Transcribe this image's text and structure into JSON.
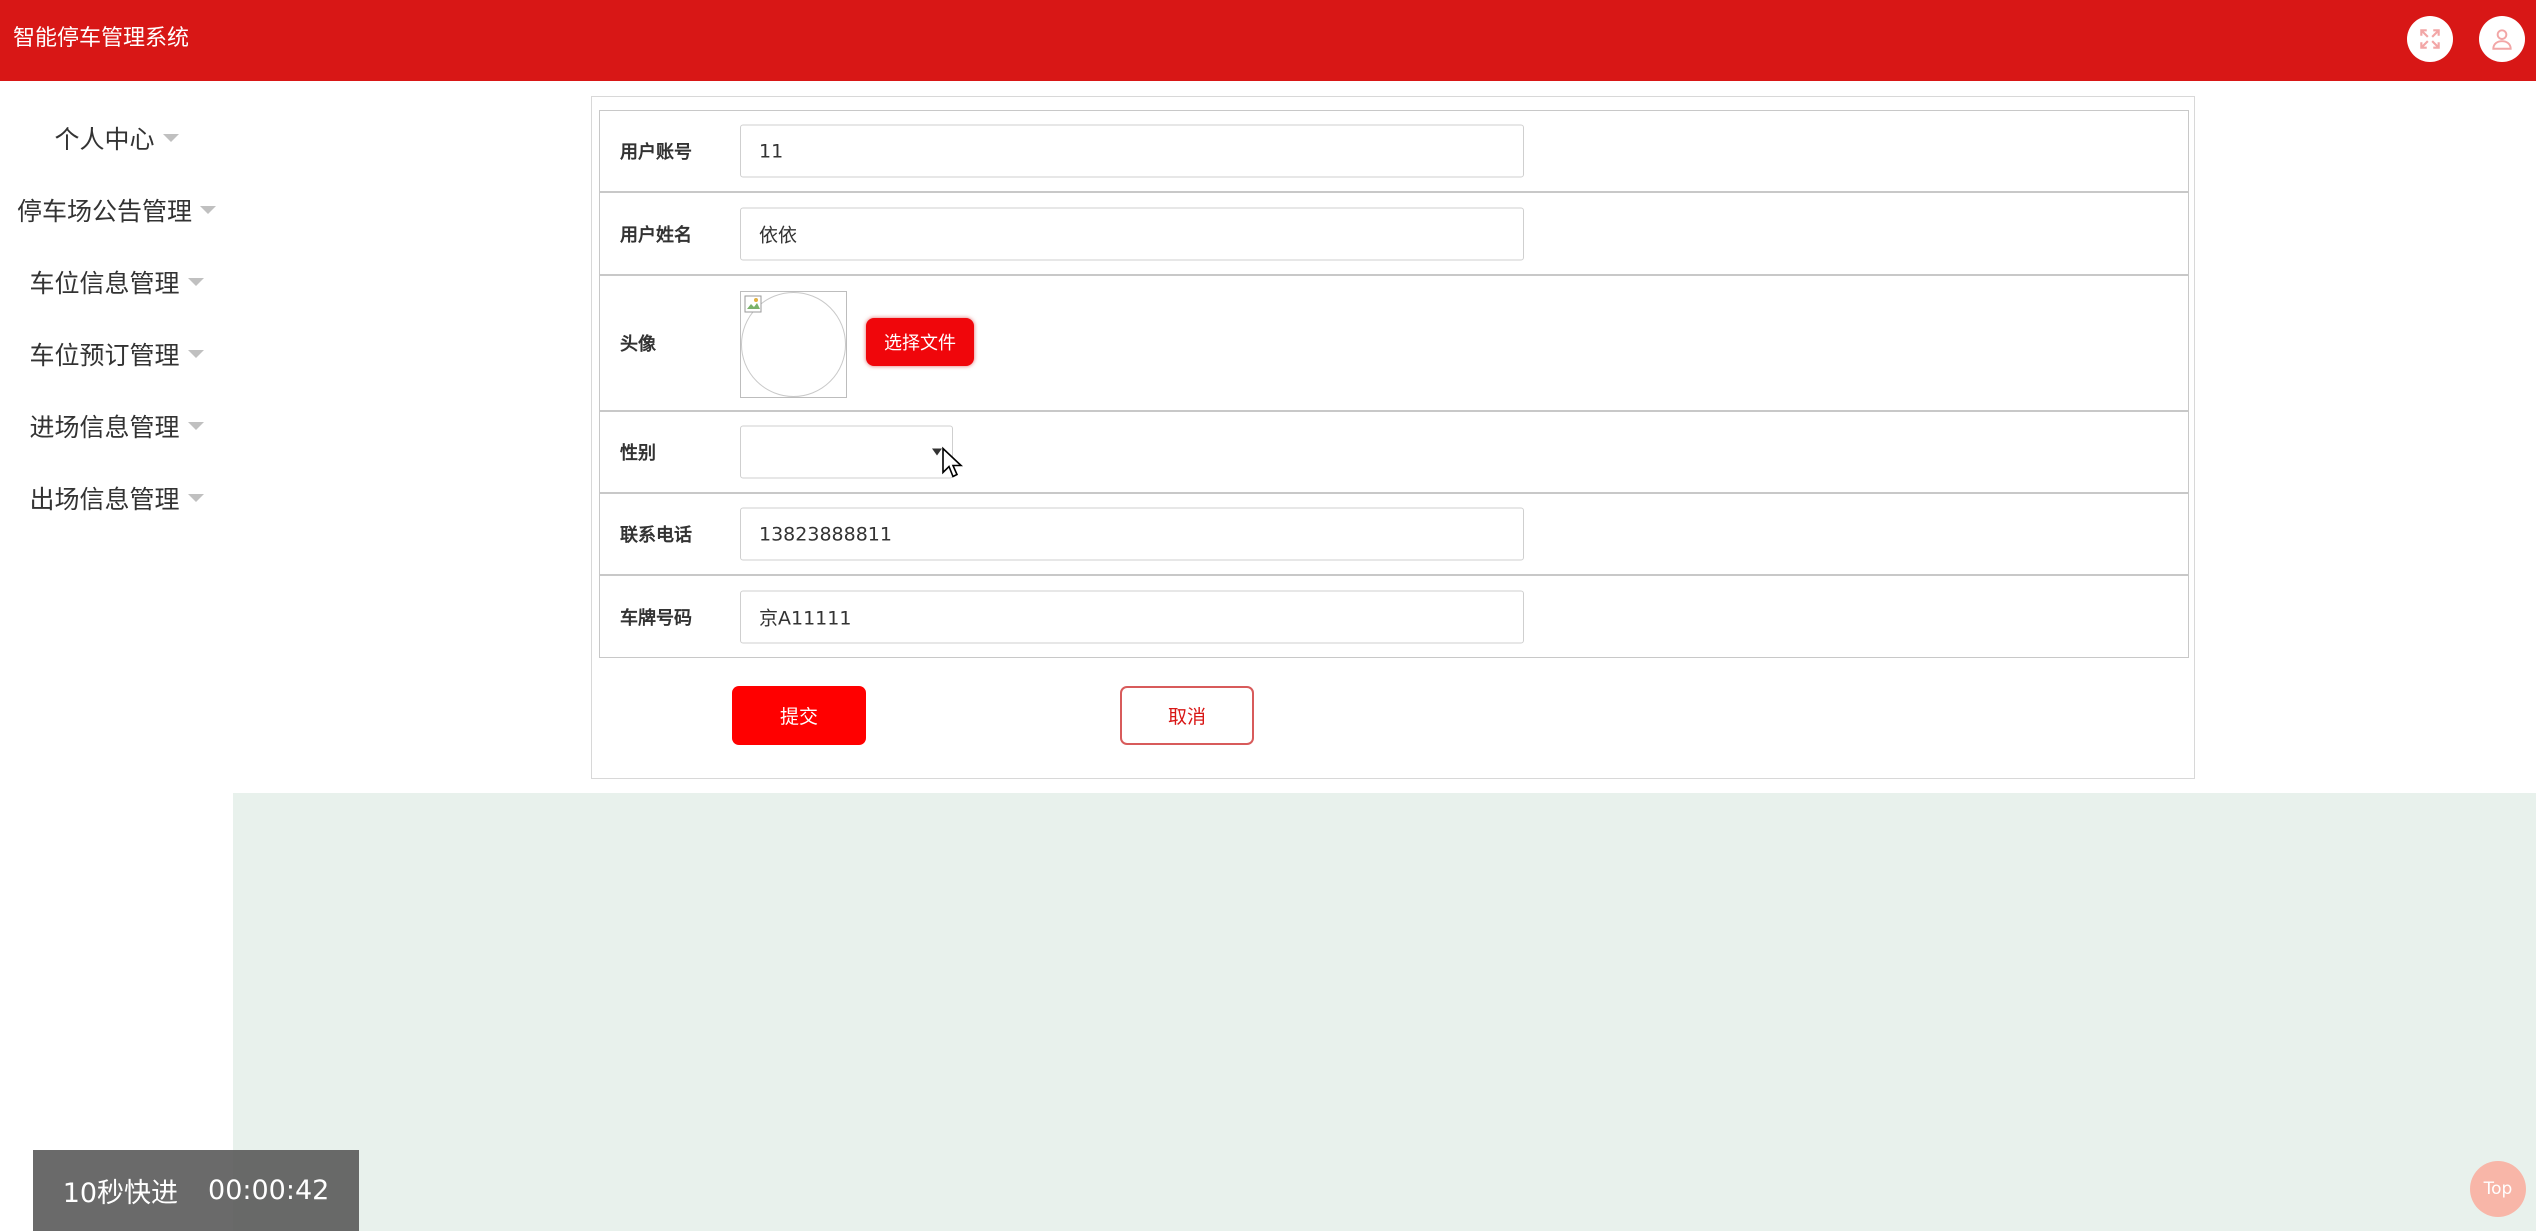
{
  "header": {
    "app_title": "智能停车管理系统",
    "fullscreen_icon": "expand-icon",
    "user_icon": "user-icon",
    "brand_color": "#d81716"
  },
  "sidebar": {
    "items": [
      {
        "label": "个人中心"
      },
      {
        "label": "停车场公告管理"
      },
      {
        "label": "车位信息管理"
      },
      {
        "label": "车位预订管理"
      },
      {
        "label": "进场信息管理"
      },
      {
        "label": "出场信息管理"
      }
    ]
  },
  "form": {
    "account": {
      "label": "用户账号",
      "value": "11"
    },
    "name": {
      "label": "用户姓名",
      "value": "依依"
    },
    "avatar": {
      "label": "头像",
      "upload_label": "选择文件"
    },
    "gender": {
      "label": "性别",
      "value": ""
    },
    "phone": {
      "label": "联系电话",
      "value": "13823888811"
    },
    "plate": {
      "label": "车牌号码",
      "value": "京A11111"
    },
    "submit_label": "提交",
    "cancel_label": "取消"
  },
  "overlay": {
    "fast_forward_label": "10秒快进",
    "time": "00:00:42"
  },
  "back_to_top_label": "Top"
}
